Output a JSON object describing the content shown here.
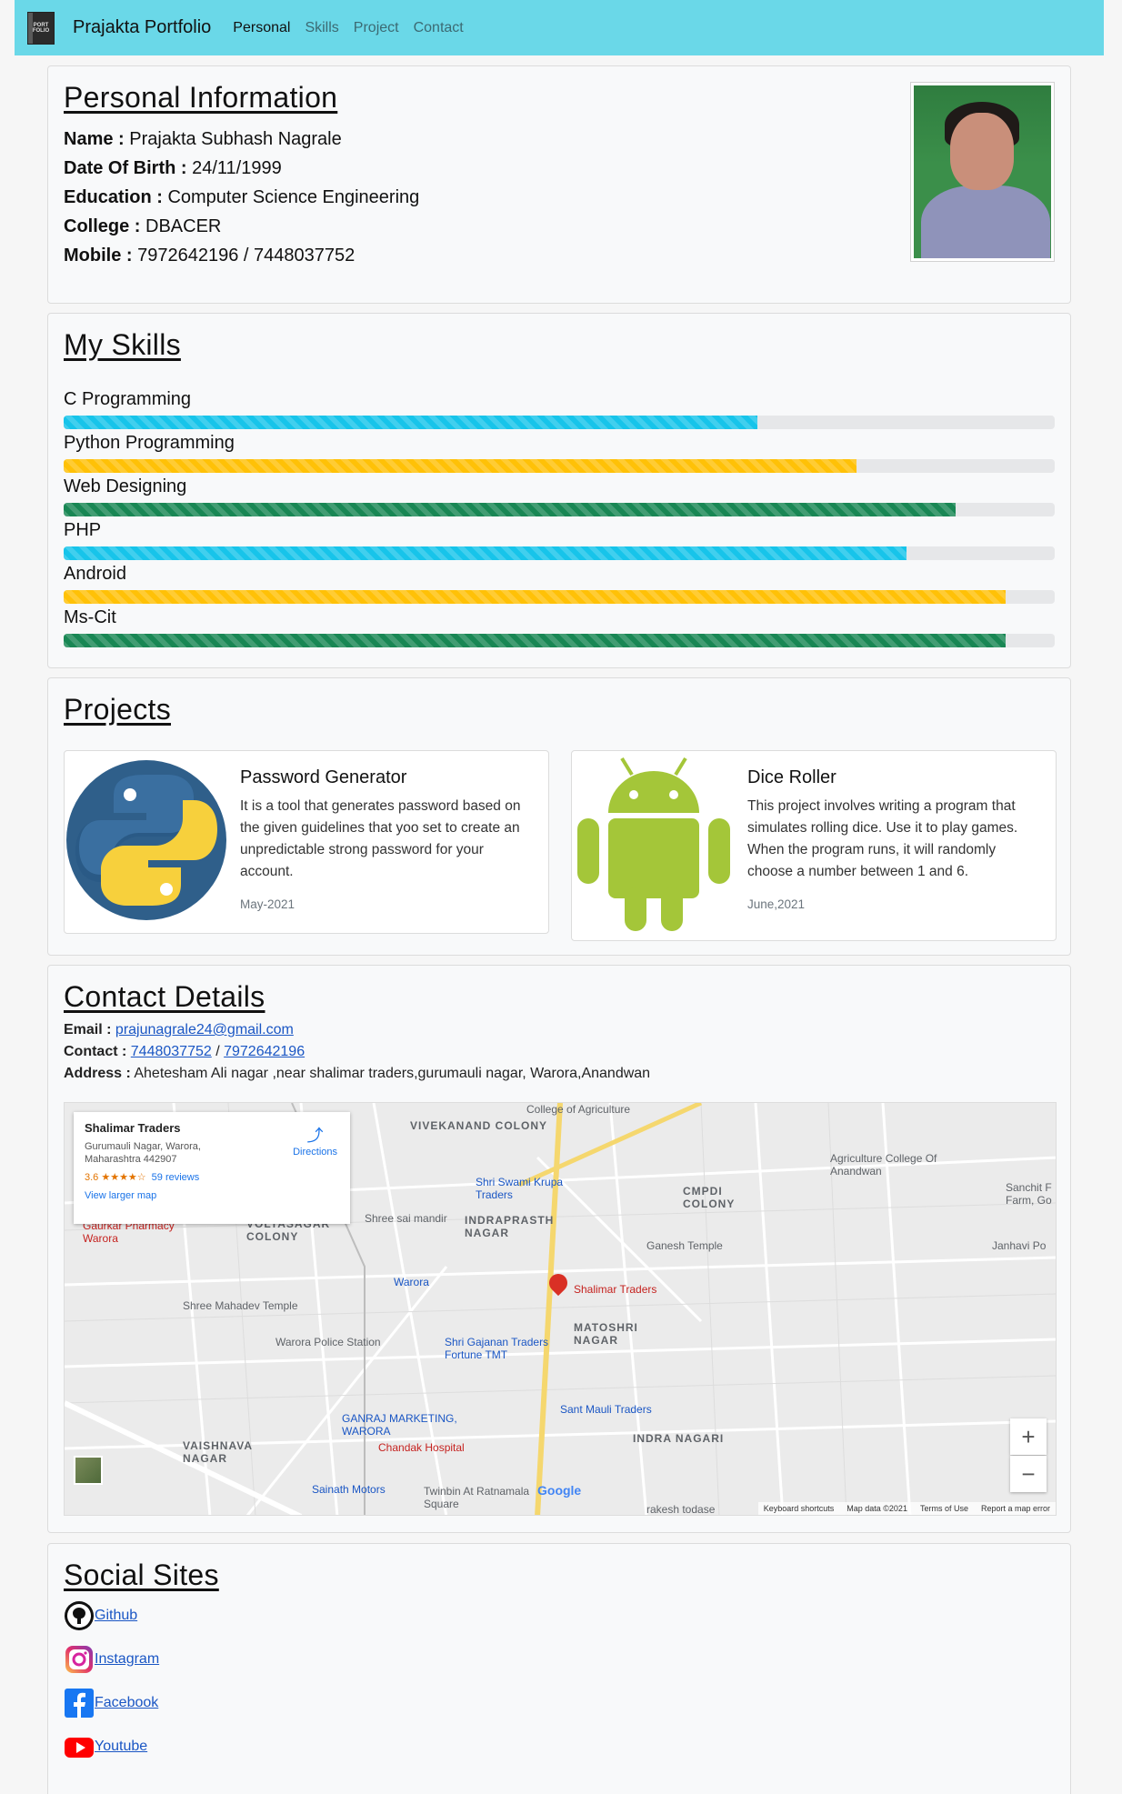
{
  "navbar": {
    "logo_text": "PORT FOLIO",
    "brand": "Prajakta Portfolio",
    "links": [
      "Personal",
      "Skills",
      "Project",
      "Contact"
    ]
  },
  "personal": {
    "title": "Personal Information",
    "rows": [
      {
        "label": "Name :",
        "value": " Prajakta Subhash Nagrale"
      },
      {
        "label": "Date Of Birth :",
        "value": " 24/11/1999"
      },
      {
        "label": "Education :",
        "value": " Computer Science Engineering"
      },
      {
        "label": "College :",
        "value": " DBACER"
      },
      {
        "label": "Mobile :",
        "value": " 7972642196 / 7448037752"
      }
    ]
  },
  "skills": {
    "title": "My Skills",
    "items": [
      {
        "label": "C Programming",
        "percent": 70,
        "color": "info"
      },
      {
        "label": "Python Programming",
        "percent": 80,
        "color": "warning"
      },
      {
        "label": "Web Designing",
        "percent": 90,
        "color": "success"
      },
      {
        "label": "PHP",
        "percent": 85,
        "color": "info"
      },
      {
        "label": "Android",
        "percent": 95,
        "color": "warning"
      },
      {
        "label": "Ms-Cit",
        "percent": 95,
        "color": "success"
      }
    ]
  },
  "projects": {
    "title": "Projects",
    "items": [
      {
        "title": "Password Generator",
        "text": "It is a tool that generates password based on the given guidelines that yoo set to create an unpredictable strong password for your account.",
        "date": "May-2021",
        "icon": "python-logo-icon"
      },
      {
        "title": "Dice Roller",
        "text": "This project involves writing a program that simulates rolling dice. Use it to play games. When the program runs, it will randomly choose a number between 1 and 6.",
        "date": "June,2021",
        "icon": "android-logo-icon"
      }
    ]
  },
  "contact": {
    "title": "Contact Details",
    "email_label": "Email :",
    "email": "prajunagrale24@gmail.com",
    "contact_label": "Contact :",
    "phone1": "7448037752",
    "phone_sep": " / ",
    "phone2": "7972642196",
    "address_label": "Address :",
    "address": " Ahetesham Ali nagar ,near shalimar traders,gurumauli nagar, Warora,Anandwan"
  },
  "map": {
    "place_name": "Shalimar Traders",
    "address_line1": "Gurumauli Nagar, Warora,",
    "address_line2": "Maharashtra 442907",
    "rating": "3.6 ★★★★☆",
    "reviews": "59 reviews",
    "larger_map": "View larger map",
    "directions": "Directions",
    "labels": [
      "College of Agriculture",
      "VIVEKANAND COLONY",
      "Shri Swami Krupa Traders",
      "Agriculture College Of Anandwan",
      "Sanchit F Farm, Go",
      "CMPDI COLONY",
      "Shree sai mandir",
      "INDRAPRASTH NAGAR",
      "Ganesh Temple",
      "Janhavi Po",
      "Gaurkar Pharmacy Warora",
      "VOLTASAGAR COLONY",
      "Warora",
      "Shalimar Traders",
      "Shree Mahadev Temple",
      "Warora Police Station",
      "Shri Gajanan Traders Fortune TMT",
      "MATOSHRI NAGAR",
      "Sant Mauli Traders",
      "GANRAJ MARKETING, WARORA",
      "VAISHNAVA NAGAR",
      "Chandak Hospital",
      "INDRA NAGARI",
      "Sainath Motors",
      "Twinbin At Ratnamala Square",
      "rakesh todase"
    ],
    "footer": [
      "Keyboard shortcuts",
      "Map data ©2021",
      "Terms of Use",
      "Report a map error"
    ],
    "google": "Google"
  },
  "social": {
    "title": "Social Sites",
    "items": [
      {
        "label": "Github",
        "icon": "github-icon"
      },
      {
        "label": "Instagram",
        "icon": "instagram-icon"
      },
      {
        "label": "Facebook",
        "icon": "facebook-icon"
      },
      {
        "label": "Youtube",
        "icon": "youtube-icon"
      }
    ]
  }
}
